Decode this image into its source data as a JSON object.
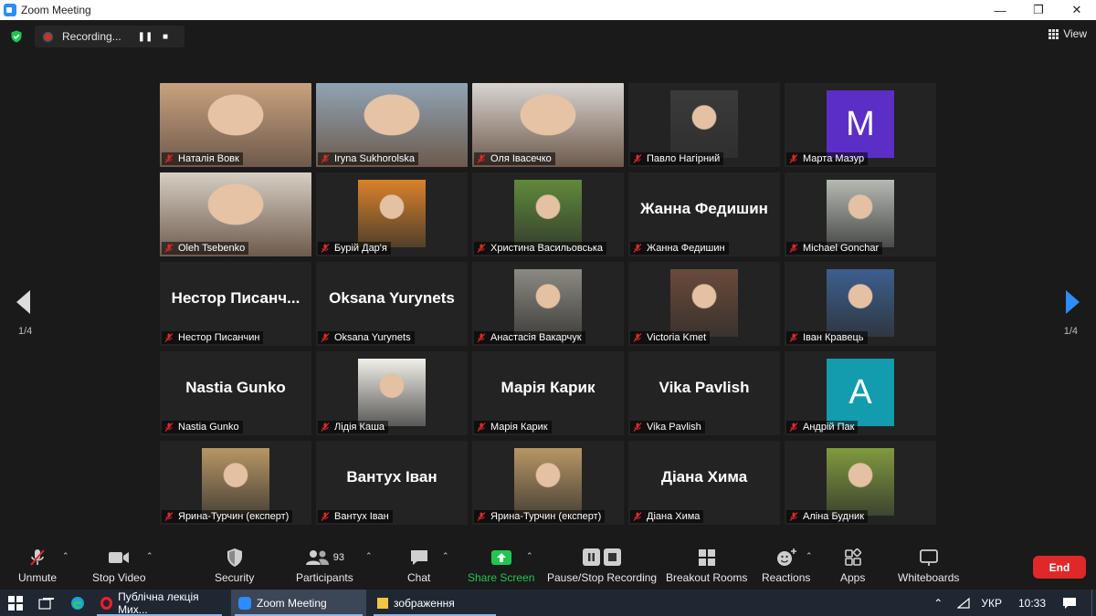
{
  "window": {
    "title": "Zoom Meeting",
    "minimize": "—",
    "restore": "❐",
    "close": "✕"
  },
  "recording": {
    "label": "Recording...",
    "pause_icon": "❚❚",
    "stop_icon": "■"
  },
  "view": {
    "label": "View"
  },
  "pagination": {
    "left": "1/4",
    "right": "1/4"
  },
  "participants": [
    {
      "name": "Наталія Вовк",
      "kind": "photo",
      "bg": "#c9a27e"
    },
    {
      "name": "Iryna Sukhorolska",
      "kind": "photo",
      "bg": "#8fa4b4"
    },
    {
      "name": "Оля Івасечко",
      "kind": "photo",
      "bg": "#d8d4d0"
    },
    {
      "name": "Павло Нагірний",
      "kind": "avatar",
      "bg": "#3b3b3b"
    },
    {
      "name": "Марта Мазур",
      "kind": "letter",
      "letter": "M",
      "bg": "#5b2ec5"
    },
    {
      "name": "Oleh Tsebenko",
      "kind": "photo",
      "bg": "#d6cfc4",
      "active": true
    },
    {
      "name": "Бурій Дар'я",
      "kind": "avatar",
      "bg": "#d9822b"
    },
    {
      "name": "Христина Васильовська",
      "kind": "avatar",
      "bg": "#5f8a3a"
    },
    {
      "name": "Жанна Федишин",
      "kind": "text",
      "display": "Жанна Федишин"
    },
    {
      "name": "Michael Gonchar",
      "kind": "avatar",
      "bg": "#b5b9b3"
    },
    {
      "name": "Нестор Писанчин",
      "kind": "text",
      "display": "Нестор Писанч..."
    },
    {
      "name": "Oksana Yurynets",
      "kind": "text",
      "display": "Oksana Yurynets"
    },
    {
      "name": "Анастасія Вакарчук",
      "kind": "avatar",
      "bg": "#8c8a82"
    },
    {
      "name": "Victoria Kmet",
      "kind": "avatar",
      "bg": "#6b4a3a"
    },
    {
      "name": "Іван Кравець",
      "kind": "avatar",
      "bg": "#3c5f8f"
    },
    {
      "name": "Nastia Gunko",
      "kind": "text",
      "display": "Nastia Gunko"
    },
    {
      "name": "Лідія Каша",
      "kind": "avatar",
      "bg": "#f1efe9"
    },
    {
      "name": "Марія Карик",
      "kind": "text",
      "display": "Марія Карик"
    },
    {
      "name": "Vika Pavlish",
      "kind": "text",
      "display": "Vika Pavlish"
    },
    {
      "name": "Андрій Пак",
      "kind": "letter",
      "letter": "A",
      "bg": "#129cad"
    },
    {
      "name": "Ярина-Турчин (експерт)",
      "kind": "avatar",
      "bg": "#b89664"
    },
    {
      "name": "Вантух Іван",
      "kind": "text",
      "display": "Вантух Іван"
    },
    {
      "name": "Ярина-Турчин (експерт)",
      "kind": "avatar",
      "bg": "#b89664"
    },
    {
      "name": "Діана Хима",
      "kind": "text",
      "display": "Діана Хима"
    },
    {
      "name": "Аліна Будник",
      "kind": "avatar",
      "bg": "#7f9a3e"
    }
  ],
  "toolbar": {
    "unmute": "Unmute",
    "stop_video": "Stop Video",
    "security": "Security",
    "participants": "Participants",
    "participants_count": "93",
    "chat": "Chat",
    "share_screen": "Share Screen",
    "pause_stop_recording": "Pause/Stop Recording",
    "breakout_rooms": "Breakout Rooms",
    "reactions": "Reactions",
    "apps": "Apps",
    "whiteboards": "Whiteboards",
    "end": "End"
  },
  "taskbar": {
    "apps": [
      {
        "label": "Публічна лекція Мих...",
        "icon": "opera-icon"
      },
      {
        "label": "Zoom Meeting",
        "icon": "zoom-icon"
      },
      {
        "label": "зображення",
        "icon": "folder-icon"
      }
    ],
    "language": "УКР",
    "time": "10:33"
  },
  "colors": {
    "accent": "#2d8cff",
    "end": "#e02828",
    "share": "#23c552",
    "active_speaker": "#a6e22e"
  }
}
